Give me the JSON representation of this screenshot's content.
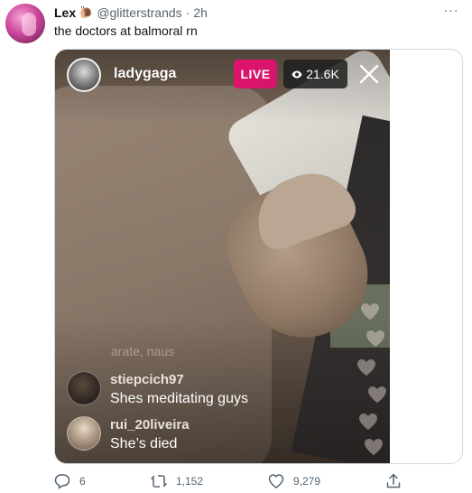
{
  "tweet": {
    "author_name": "Lex",
    "author_emoji": "🐌",
    "handle": "@glitterstrands",
    "separator": "·",
    "time": "2h",
    "more_label": "···",
    "text": "the doctors at balmoral rn"
  },
  "live": {
    "username": "ladygaga",
    "live_label": "LIVE",
    "viewers": "21.6K",
    "faded_comment": "arate, naus",
    "comments": [
      {
        "user": "stiepcich97",
        "text": "Shes meditating guys"
      },
      {
        "user": "rui_20liveira",
        "text": "She’s died"
      }
    ]
  },
  "actions": {
    "replies": "6",
    "retweets": "1,152",
    "likes": "9,279"
  },
  "colors": {
    "live_badge": "#e0126d",
    "text_secondary": "#536471",
    "card_border": "#cfd9de"
  },
  "icons": [
    "more-icon",
    "eye-icon",
    "close-icon",
    "reply-icon",
    "retweet-icon",
    "like-icon",
    "share-icon",
    "heart-icon"
  ]
}
